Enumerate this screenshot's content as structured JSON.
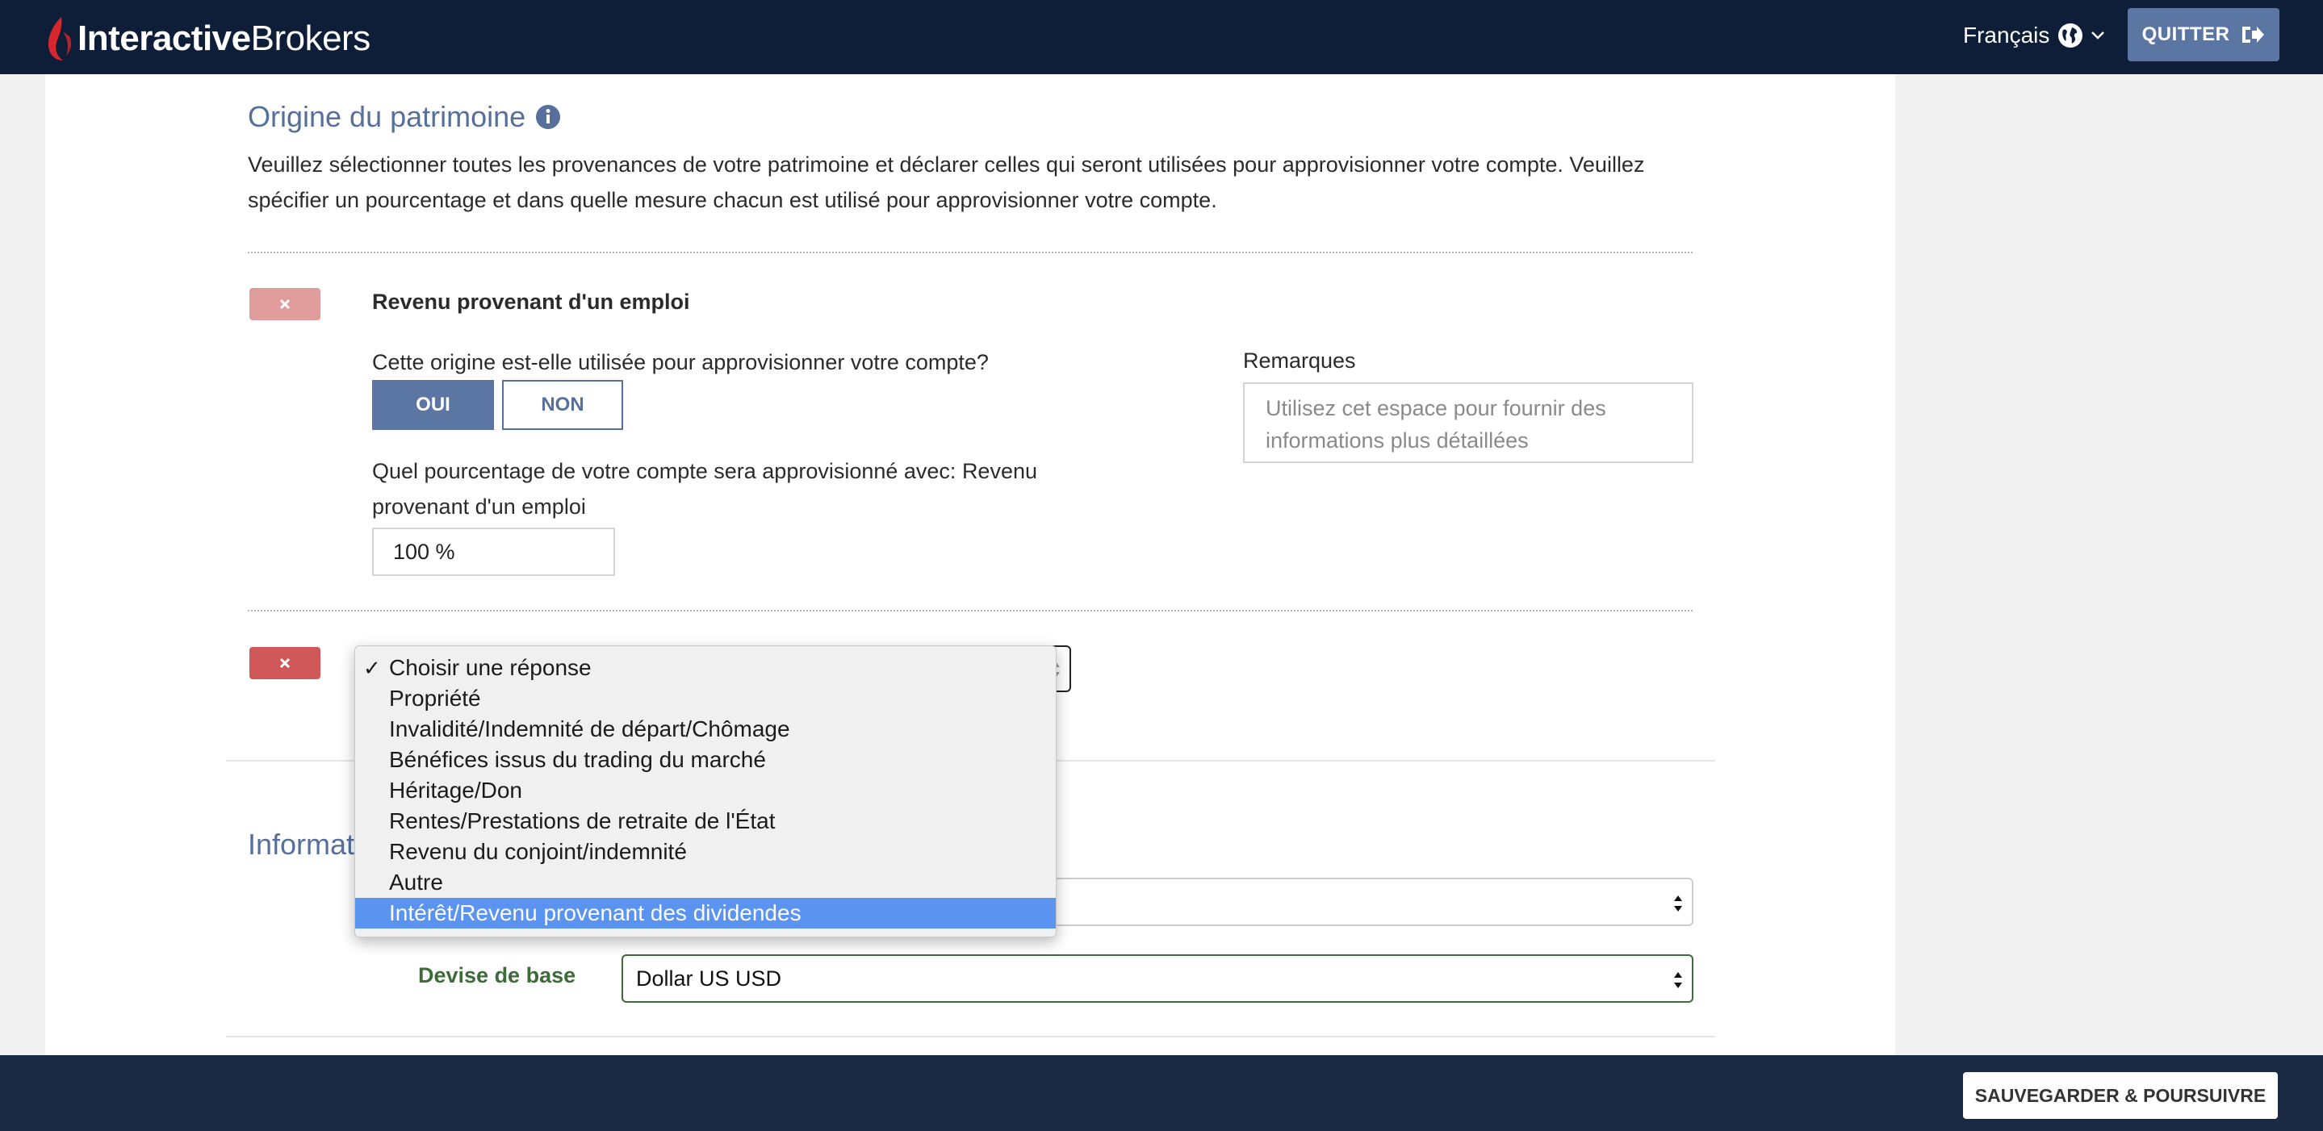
{
  "header": {
    "brand_bold": "Interactive",
    "brand_light": "Brokers",
    "language": "Français",
    "quit_label": "QUITTER"
  },
  "wealth": {
    "title": "Origine du patrimoine",
    "intro": "Veuillez sélectionner toutes les provenances de votre patrimoine et déclarer celles qui seront utilisées pour approvisionner votre compte. Veuillez spécifier un pourcentage et dans quelle mesure chacun est utilisé pour approvisionner votre compte.",
    "source1": {
      "title": "Revenu provenant d'un emploi",
      "question": "Cette origine est-elle utilisée pour approvisionner votre compte?",
      "yes": "OUI",
      "no": "NON",
      "percent_question": "Quel pourcentage de votre compte sera approvisionné avec: Revenu provenant d'un emploi",
      "percent_value": "100 %",
      "remarks_label": "Remarques",
      "remarks_placeholder": "Utilisez cet espace pour fournir des informations plus détaillées"
    }
  },
  "dropdown": {
    "options": [
      "Choisir une réponse",
      "Propriété",
      "Invalidité/Indemnité de départ/Chômage",
      "Bénéfices issus du trading du marché",
      "Héritage/Don",
      "Rentes/Prestations de retraite de l'État",
      "Revenu du conjoint/indemnité",
      "Autre",
      "Intérêt/Revenu provenant des dividendes"
    ],
    "checked_index": 0,
    "highlighted_index": 8
  },
  "info": {
    "title_visible": "Informati",
    "base_currency_label": "Devise de base",
    "base_currency_value": "Dollar US USD"
  },
  "footer": {
    "save_label": "SAUVEGARDER & POURSUIVRE"
  },
  "colors": {
    "header_bg": "#0f1e38",
    "accent": "#5b76a3",
    "danger": "#d05858",
    "green_label": "#3e6b3a",
    "highlight": "#5a94f0"
  }
}
